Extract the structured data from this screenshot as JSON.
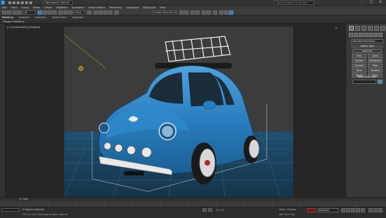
{
  "app": {
    "logo_letter": "3",
    "workspace_label": "Workspace: Default",
    "search_placeholder": "Type a keyword or phrase"
  },
  "window_controls": {
    "minimize": "–",
    "maximize": "□",
    "close": "✕"
  },
  "menu": [
    "Edit",
    "Tools",
    "Group",
    "Views",
    "Create",
    "Modifiers",
    "Animation",
    "Graph Editors",
    "Rendering",
    "Customize",
    "MAXScript",
    "Help"
  ],
  "toolbar": {
    "filter_dropdown": "All",
    "view_dropdown": "View",
    "selection_set_dropdown": "Create Selection Se"
  },
  "ribbon": {
    "tabs": [
      "Modeling",
      "Freeform",
      "Selection",
      "Object Paint",
      "Populate"
    ],
    "active_tab": "Modeling",
    "sub_label": "Polygon Modeling"
  },
  "viewport": {
    "label": "[+] [Camera001] [Shaded]",
    "corner_mark": "+"
  },
  "command_panel": {
    "category_dropdown": "Standard Primitives",
    "object_type_title": "Object Type",
    "autogrid_label": "AutoGrid",
    "object_buttons": [
      "Box",
      "Cone",
      "Sphere",
      "GeoSphere",
      "Cylinder",
      "Tube",
      "Torus",
      "Pyramid",
      "Teapot",
      "Plane"
    ],
    "name_color_title": "Name and Color"
  },
  "timeline": {
    "frame_label": "0 / 100"
  },
  "status": {
    "selection": "0 Objects Selected",
    "prompt": "Click or click-and-drag to select objects",
    "coords": "X:      Y:      Z:",
    "grid": "Grid = 10.0cm",
    "add_time_tag": "Add Time Tag",
    "key_filter": "Selected"
  },
  "colors": {
    "car_body": "#2a7ec0",
    "viewport_bg": "#3c3c3c",
    "floor": "#1d4561",
    "accent": "#3b76b0"
  }
}
